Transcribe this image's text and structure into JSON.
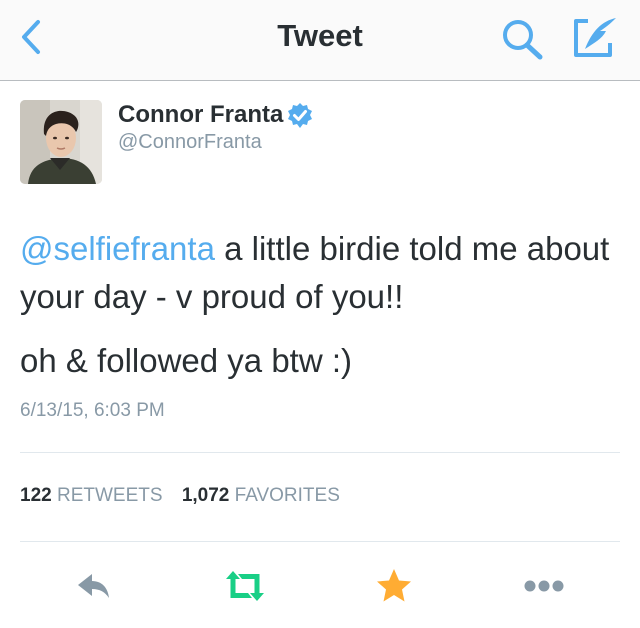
{
  "navbar": {
    "title": "Tweet",
    "back_icon": "chevron-left-icon",
    "search_icon": "search-icon",
    "compose_icon": "compose-tweet-icon"
  },
  "tweet": {
    "author": {
      "name": "Connor Franta",
      "handle": "@ConnorFranta",
      "verified": true,
      "avatar_icon": "profile-photo"
    },
    "text": {
      "mention": "@selfiefranta",
      "line1_rest": " a little birdie told me about your day - v proud of you!!",
      "paragraph2": "oh & followed ya btw :)"
    },
    "timestamp": "6/13/15, 6:03 PM",
    "stats": {
      "retweets_count": "122",
      "retweets_label": "RETWEETS",
      "favorites_count": "1,072",
      "favorites_label": "FAVORITES"
    }
  },
  "actions": {
    "reply_icon": "reply-icon",
    "retweet_icon": "retweet-icon",
    "favorite_icon": "star-icon",
    "more_icon": "more-icon"
  },
  "colors": {
    "accent": "#55acee",
    "retweeted": "#19cf86",
    "favorited": "#ffac33",
    "muted": "#8899a6",
    "text": "#292f33"
  }
}
